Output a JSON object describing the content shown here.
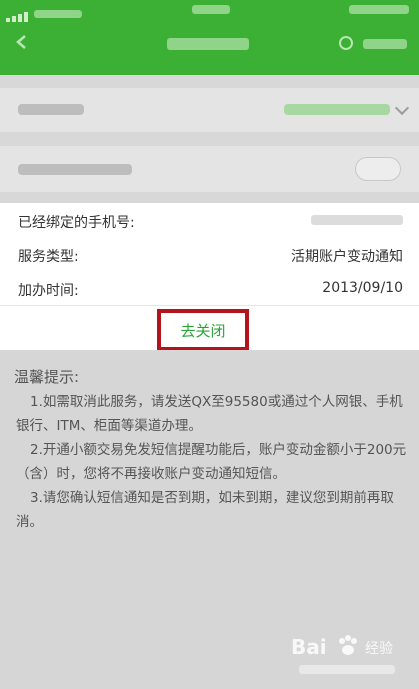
{
  "info": {
    "phone_label": "已经绑定的手机号:",
    "service_label": "服务类型:",
    "service_value": "活期账户变动通知",
    "date_label": "加办时间:",
    "date_value": "2013/09/10"
  },
  "actions": {
    "close_label": "去关闭"
  },
  "tips": {
    "title": "温馨提示:",
    "items": [
      "1.如需取消此服务，请发送QX至95580或通过个人网银、手机银行、ITM、柜面等渠道办理。",
      "2.开通小额交易免发短信提醒功能后，账户变动金额小于200元（含）时，您将不再接收账户变动通知短信。",
      "3.请您确认短信通知是否到期，如未到期，建议您到期前再取消。"
    ]
  },
  "watermark": {
    "logo": "Bai",
    "logo_tail": "经验"
  },
  "colors": {
    "header_green": "#3cb034",
    "accent_green": "#2aa33a",
    "highlight_red": "#b3141c"
  }
}
